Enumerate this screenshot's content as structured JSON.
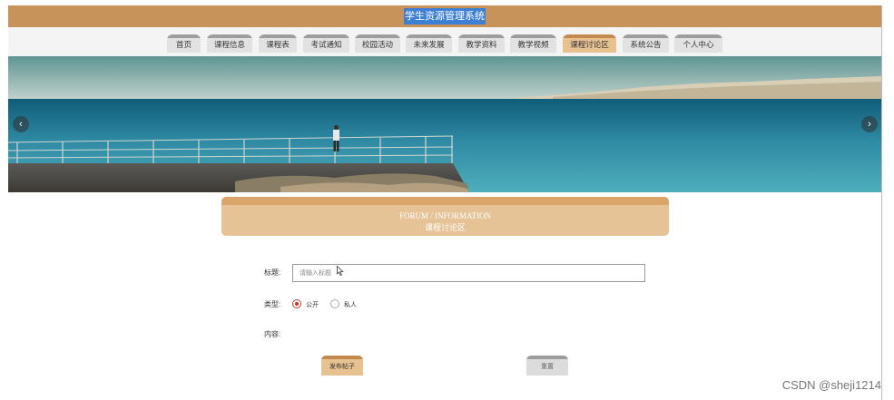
{
  "header": {
    "site_title": "学生资源管理系统"
  },
  "nav": {
    "items": [
      {
        "label": "首页"
      },
      {
        "label": "课程信息"
      },
      {
        "label": "课程表"
      },
      {
        "label": "考试通知"
      },
      {
        "label": "校园活动"
      },
      {
        "label": "未来发展"
      },
      {
        "label": "教学资料"
      },
      {
        "label": "教学视频"
      },
      {
        "label": "课程讨论区",
        "active": true
      },
      {
        "label": "系统公告"
      },
      {
        "label": "个人中心"
      }
    ]
  },
  "banner": {
    "prev_symbol": "‹",
    "next_symbol": "›"
  },
  "section": {
    "title_en": "FORUM / INFORMATION",
    "title_cn": "课程讨论区"
  },
  "form": {
    "title_label": "标题:",
    "title_placeholder": "请输入标题",
    "type_label": "类型:",
    "type_options": [
      {
        "label": "公开",
        "checked": true
      },
      {
        "label": "私人",
        "checked": false
      }
    ],
    "content_label": "内容:",
    "submit_label": "发布帖子",
    "reset_label": "重置"
  },
  "watermark": "CSDN @sheji1214",
  "colors": {
    "brand": "#c8935b",
    "active_tab": "#e7c190",
    "title_highlight": "#3e7fd6"
  }
}
